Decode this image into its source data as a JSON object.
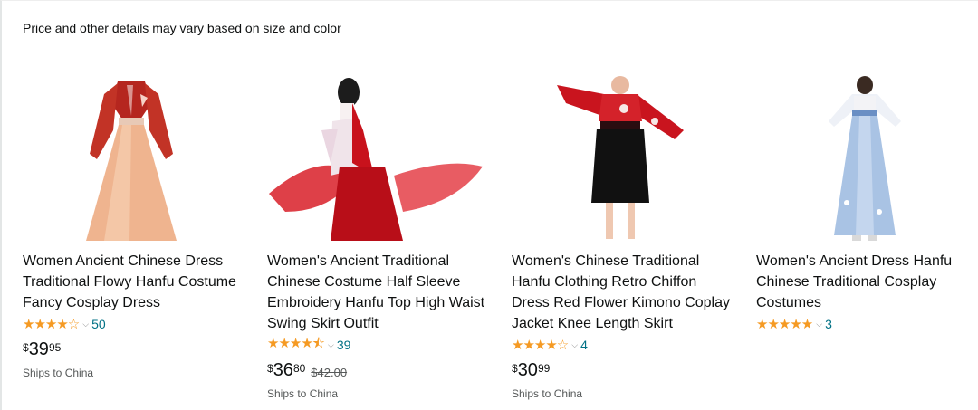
{
  "notice": "Price and other details may vary based on size and color",
  "products": [
    {
      "title": "Women Ancient Chinese Dress Traditional Flowy Hanfu Costume Fancy Cosplay Dress",
      "stars": "★★★★☆",
      "rating": 4.0,
      "review_count": "50",
      "price_whole": "39",
      "price_frac": "95",
      "list_price": "",
      "shipping": "Ships to China"
    },
    {
      "title": "Women's Ancient Traditional Chinese Costume Half Sleeve Embroidery Hanfu Top High Waist Swing Skirt Outfit",
      "stars": "★★★★⯪",
      "rating": 4.5,
      "review_count": "39",
      "price_whole": "36",
      "price_frac": "80",
      "list_price": "$42.00",
      "shipping": "Ships to China"
    },
    {
      "title": "Women's Chinese Traditional Hanfu Clothing Retro Chiffon Dress Red Flower Kimono Coplay Jacket Knee Length Skirt",
      "stars": "★★★★☆",
      "rating": 4.0,
      "review_count": "4",
      "price_whole": "30",
      "price_frac": "99",
      "list_price": "",
      "shipping": "Ships to China"
    },
    {
      "title": "Women's Ancient Dress Hanfu Chinese Traditional Cosplay Costumes",
      "stars": "★★★★★",
      "rating": 5.0,
      "review_count": "3",
      "price_whole": "",
      "price_frac": "",
      "list_price": "",
      "shipping": ""
    }
  ],
  "currency": "$",
  "colors": {
    "star": "#f59a23",
    "link": "#007185",
    "muted": "#565959"
  }
}
